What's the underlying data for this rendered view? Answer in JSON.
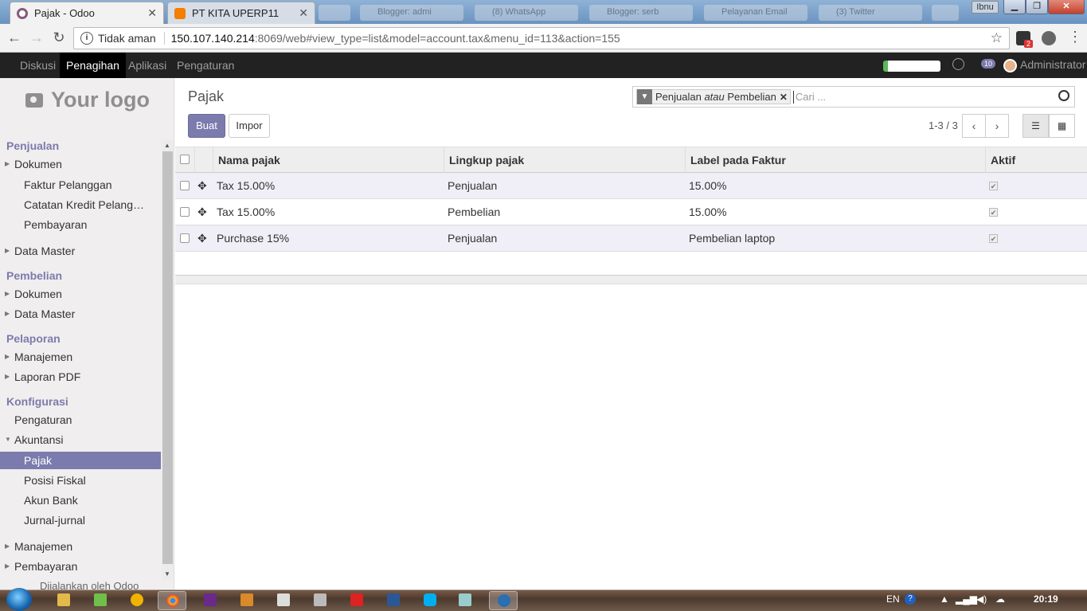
{
  "browser": {
    "tabs": [
      {
        "title": "Pajak - Odoo",
        "active": true
      },
      {
        "title": "PT KITA UPERP11",
        "active": false
      }
    ],
    "ghost_tabs": [
      "Blogger: admi",
      "(8) WhatsApp",
      "Blogger: serb",
      "Pelayanan Email",
      "(3) Twitter",
      ""
    ],
    "window_user": "Ibnu",
    "address": {
      "security": "Tidak aman",
      "host": "150.107.140.214",
      "path": ":8069/web#view_type=list&model=account.tax&menu_id=113&action=155"
    },
    "ext_badge": "2"
  },
  "topnav": {
    "items": [
      {
        "label": "Diskusi",
        "active": false
      },
      {
        "label": "Penagihan",
        "active": true
      },
      {
        "label": "Aplikasi",
        "active": false
      },
      {
        "label": "Pengaturan",
        "active": false
      }
    ],
    "messages_count": "10",
    "user": "Administrator"
  },
  "sidebar": {
    "logo_text": "Your logo",
    "sections": [
      {
        "title": "Penjualan",
        "items": [
          {
            "label": "Dokumen",
            "level": 1,
            "caret": "right"
          },
          {
            "label": "Faktur Pelanggan",
            "level": 2
          },
          {
            "label": "Catatan Kredit Pelang…",
            "level": 2
          },
          {
            "label": "Pembayaran",
            "level": 2
          },
          {
            "label": "Data Master",
            "level": 1,
            "caret": "right"
          }
        ]
      },
      {
        "title": "Pembelian",
        "items": [
          {
            "label": "Dokumen",
            "level": 1,
            "caret": "right"
          },
          {
            "label": "Data Master",
            "level": 1,
            "caret": "right"
          }
        ]
      },
      {
        "title": "Pelaporan",
        "items": [
          {
            "label": "Manajemen",
            "level": 1,
            "caret": "right"
          },
          {
            "label": "Laporan PDF",
            "level": 1,
            "caret": "right"
          }
        ]
      },
      {
        "title": "Konfigurasi",
        "items": [
          {
            "label": "Pengaturan",
            "level": 1
          },
          {
            "label": "Akuntansi",
            "level": 1,
            "caret": "down"
          },
          {
            "label": "Pajak",
            "level": 2,
            "active": true
          },
          {
            "label": "Posisi Fiskal",
            "level": 2
          },
          {
            "label": "Akun Bank",
            "level": 2
          },
          {
            "label": "Jurnal-jurnal",
            "level": 2
          },
          {
            "label": "Manajemen",
            "level": 1,
            "caret": "right"
          },
          {
            "label": "Pembayaran",
            "level": 1,
            "caret": "right"
          }
        ]
      }
    ],
    "footer_text": "Dijalankan oleh Odoo"
  },
  "control_panel": {
    "breadcrumb": "Pajak",
    "create_label": "Buat",
    "import_label": "Impor",
    "search": {
      "facet_value_1": "Penjualan",
      "facet_separator": "atau",
      "facet_value_2": "Pembelian",
      "placeholder": "Cari ..."
    },
    "pager": "1-3 / 3"
  },
  "table": {
    "columns": [
      "Nama pajak",
      "Lingkup pajak",
      "Label pada Faktur",
      "Aktif"
    ],
    "rows": [
      {
        "name": "Tax 15.00%",
        "scope": "Penjualan",
        "label": "15.00%",
        "active": true
      },
      {
        "name": "Tax 15.00%",
        "scope": "Pembelian",
        "label": "15.00%",
        "active": true
      },
      {
        "name": "Purchase 15%",
        "scope": "Penjualan",
        "label": "Pembelian laptop",
        "active": true
      }
    ]
  },
  "taskbar": {
    "language": "EN",
    "time": "20:19"
  },
  "colors": {
    "odoo_purple": "#7c7bad",
    "topnav_bg": "#222222",
    "sidebar_bg": "#f0eeee"
  }
}
